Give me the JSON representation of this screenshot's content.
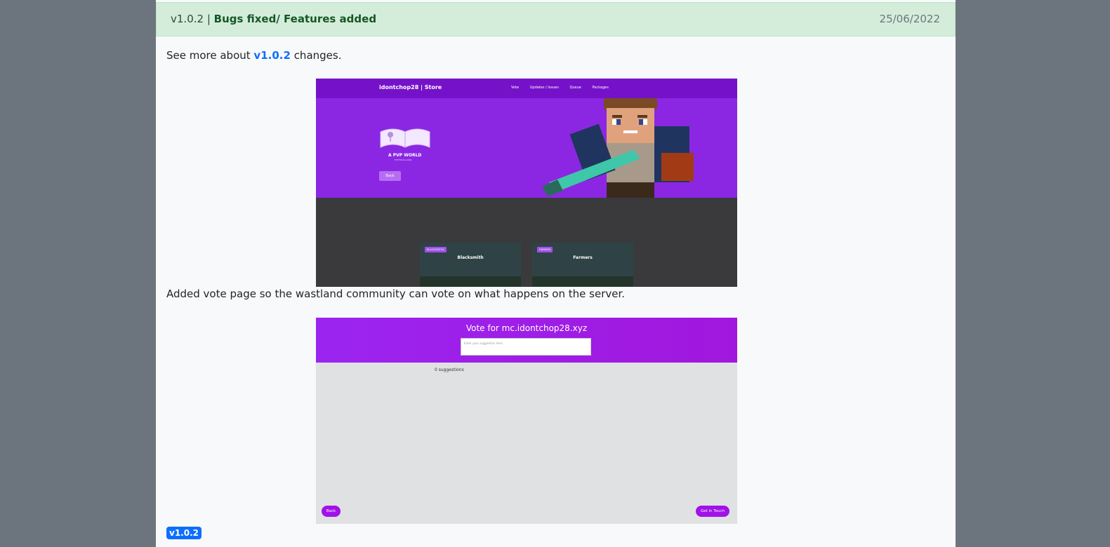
{
  "header": {
    "version": "v1.0.2",
    "separator": " | ",
    "title": "Bugs fixed/ Features added",
    "date": "25/06/2022"
  },
  "body": {
    "text1_prefix": "See more about ",
    "text1_link": "v1.0.2",
    "text1_suffix": " changes.",
    "text2": "Added vote page so the wastland community can vote on what happens on the server."
  },
  "screenshot1": {
    "brand": "idontchop28 | Store",
    "nav": [
      "Vote",
      "Updates / Issues",
      "Queue",
      "Packages"
    ],
    "logo_text": "A PVP WORLD",
    "logo_sub": "MYTHICAL.LOGS",
    "back_label": "Back",
    "cards": [
      {
        "tag": "BLACKSMITHS",
        "title": "Blacksmith"
      },
      {
        "tag": "FARMERS",
        "title": "Farmers"
      }
    ]
  },
  "screenshot2": {
    "title": "Vote for mc.idontchop28.xyz",
    "input_placeholder": "Enter your suggestion here...",
    "suggestions_label": "0 suggestions",
    "back_label": "Back",
    "contact_label": "Get in Touch"
  },
  "footer": {
    "badge": "v1.0.2"
  },
  "colors": {
    "page_bg": "#6c757d",
    "card_bg": "#f8f9fa",
    "header_bg": "#d4eddb",
    "link": "#0d6efd",
    "purple": "#8b27e3"
  }
}
